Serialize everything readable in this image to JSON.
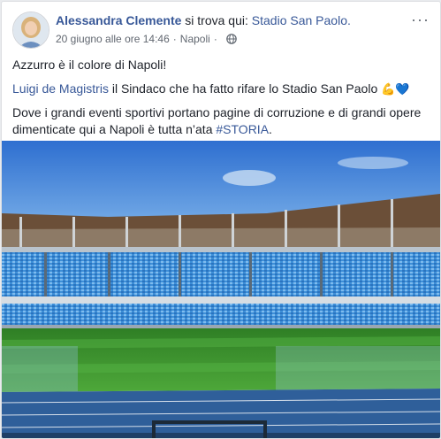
{
  "post": {
    "author": "Alessandra Clemente",
    "checkin_prefix": "si trova qui:",
    "place": "Stadio San Paolo.",
    "timestamp": "20 giugno alle ore 14:46",
    "separator": "·",
    "location": "Napoli",
    "audience_icon": "globe-icon",
    "more_label": "···",
    "line1": "Azzurro è il colore di Napoli!",
    "mention": "Luigi de Magistris",
    "line2_rest": " il Sindaco che ha fatto rifare lo Stadio San Paolo ",
    "line2_emoji": "💪💙",
    "line3": "Dove i grandi eventi sportivi portano pagine di corruzione e di grandi opere dimenticate qui a Napoli è tutta n’ata ",
    "hashtag": "#STORIA",
    "hashtag_end": "."
  },
  "colors": {
    "link": "#385898",
    "text": "#1d2129",
    "meta": "#616770",
    "seats_blue": "#3d8fd8",
    "pitch_green": "#3e9a2f",
    "track_blue": "#2f5f9a"
  }
}
